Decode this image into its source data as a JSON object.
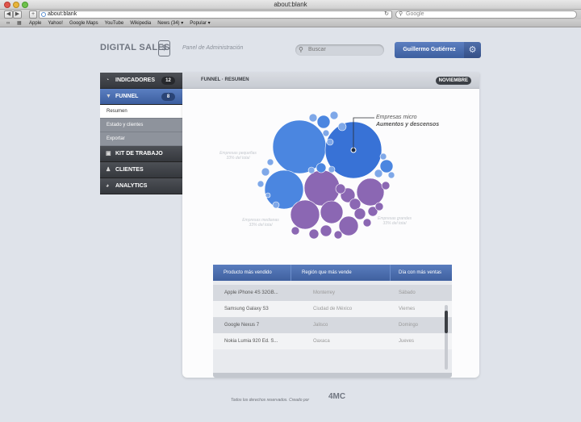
{
  "browser": {
    "window_title": "about:blank",
    "url": "about:blank",
    "search_placeholder": "Google",
    "bookmarks": [
      "Apple",
      "Yahoo!",
      "Google Maps",
      "YouTube",
      "Wikipedia",
      "News (34) ▾",
      "Popular ▾"
    ]
  },
  "header": {
    "logo_text": "DIGITAL SALES",
    "logo_mark": "$",
    "panel_title": "Panel de Administración",
    "search_placeholder": "Buscar",
    "user_name": "Guillermo Gutiérrez"
  },
  "sidebar": {
    "items": [
      {
        "label": "INDICADORES",
        "badge": "12",
        "icon": "chart-icon"
      },
      {
        "label": "FUNNEL",
        "badge": "8",
        "icon": "funnel-icon"
      },
      {
        "label": "KIT DE TRABAJO",
        "icon": "briefcase-icon"
      },
      {
        "label": "CLIENTES",
        "icon": "users-icon"
      },
      {
        "label": "ANALYTICS",
        "icon": "pie-icon"
      }
    ],
    "subitems": [
      "Resumen",
      "Estado y clientes",
      "Exportar"
    ]
  },
  "main": {
    "breadcrumb": "FUNNEL · RESUMEN",
    "month": "NOVIEMBRE",
    "annotation": {
      "line1": "Empresas micro",
      "line2": "Aumentos y descensos"
    },
    "faint_labels": [
      {
        "line1": "Empresas pequeñas",
        "line2": "33% del total"
      },
      {
        "line1": "Empresas medianas",
        "line2": "33% del total"
      },
      {
        "line1": "Empresas grandes",
        "line2": "33% del total"
      }
    ],
    "colors": {
      "blue": "#4b86e0",
      "blue_dark": "#3872d6",
      "purple": "#8b67b3",
      "light_blue": "#7fa8e8"
    },
    "table": {
      "headers": [
        "Producto más vendido",
        "Región que más vende",
        "Día con más ventas"
      ],
      "rows": [
        [
          "Apple iPhone 4S 32GB...",
          "Monterrey",
          "Sábado"
        ],
        [
          "Samsung Galaxy S3",
          "Ciudad de México",
          "Viernes"
        ],
        [
          "Google Nexus 7",
          "Jalisco",
          "Domingo"
        ],
        [
          "Nokia Lumia 920 Ed. S...",
          "Oaxaca",
          "Jueves"
        ]
      ]
    }
  },
  "footer": {
    "text": "Todos los derechos reservados. Creado por",
    "logo": "4MC"
  }
}
